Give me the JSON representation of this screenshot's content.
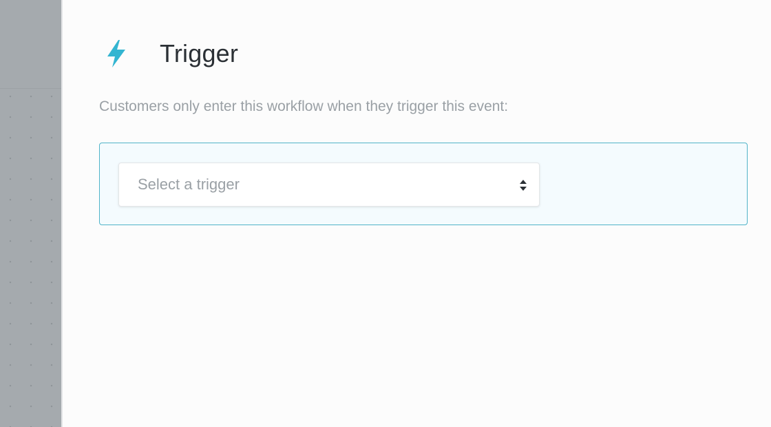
{
  "trigger_panel": {
    "title": "Trigger",
    "description": "Customers only enter this workflow when they trigger this event:",
    "icon": "lightning-bolt-icon",
    "accent_color": "#33b5d1",
    "select": {
      "placeholder": "Select a trigger",
      "value": ""
    }
  }
}
